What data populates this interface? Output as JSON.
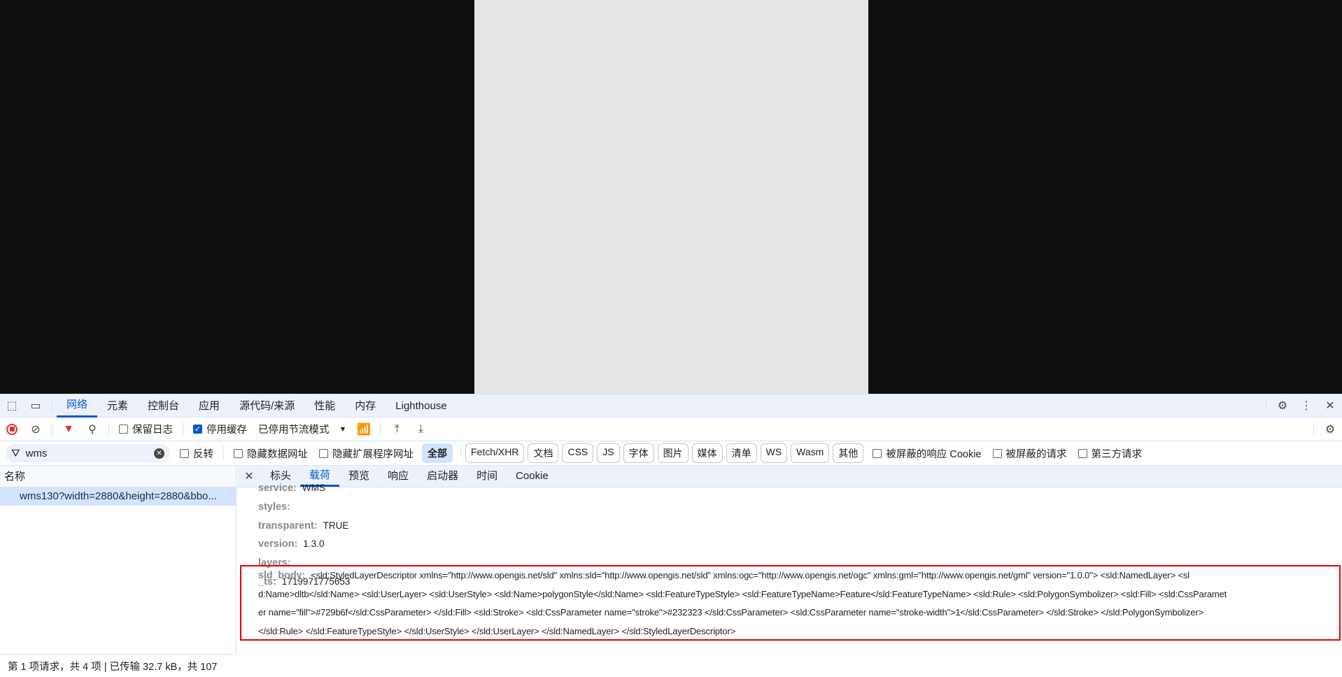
{
  "tabs": [
    "网络",
    "元素",
    "控制台",
    "应用",
    "源代码/来源",
    "性能",
    "内存",
    "Lighthouse"
  ],
  "toolbar": {
    "preserve_log": "保留日志",
    "disable_cache": "停用缓存",
    "throttle": "已停用节流模式"
  },
  "filter": {
    "value": "wms",
    "invert": "反转",
    "hide_data_urls": "隐藏数据网址",
    "hide_ext_urls": "隐藏扩展程序网址",
    "types": [
      "全部",
      "Fetch/XHR",
      "文档",
      "CSS",
      "JS",
      "字体",
      "图片",
      "媒体",
      "清单",
      "WS",
      "Wasm",
      "其他"
    ],
    "blocked_cookies": "被屏蔽的响应 Cookie",
    "blocked_requests": "被屏蔽的请求",
    "third_party": "第三方请求"
  },
  "requests": {
    "header": "名称",
    "items": [
      "wms130?width=2880&height=2880&bbo..."
    ]
  },
  "status": "第 1 项请求，共 4 项  |  已传输 32.7 kB，共 107",
  "detail_tabs": [
    "标头",
    "载荷",
    "预览",
    "响应",
    "启动器",
    "时间",
    "Cookie"
  ],
  "payload": [
    {
      "key": "service:",
      "value": "WMS"
    },
    {
      "key": "styles:",
      "value": ""
    },
    {
      "key": "transparent:",
      "value": "TRUE"
    },
    {
      "key": "version:",
      "value": "1.3.0"
    },
    {
      "key": "layers:",
      "value": ""
    },
    {
      "key": "_ts:",
      "value": "1719971775653"
    }
  ],
  "sld_body": {
    "key": "sld_body:",
    "lines": [
      "<sld:StyledLayerDescriptor xmlns=\"http://www.opengis.net/sld\" xmlns:sld=\"http://www.opengis.net/sld\" xmlns:ogc=\"http://www.opengis.net/ogc\" xmlns:gml=\"http://www.opengis.net/gml\" version=\"1.0.0\"> <sld:NamedLayer> <sl",
      "d:Name>dltb</sld:Name> <sld:UserLayer> <sld:UserStyle> <sld:Name>polygonStyle</sld:Name> <sld:FeatureTypeStyle> <sld:FeatureTypeName>Feature</sld:FeatureTypeName> <sld:Rule> <sld:PolygonSymbolizer> <sld:Fill> <sld:CssParamet",
      "er name=\"fill\">#729b6f</sld:CssParameter> </sld:Fill> <sld:Stroke> <sld:CssParameter name=\"stroke\">#232323 </sld:CssParameter> <sld:CssParameter name=\"stroke-width\">1</sld:CssParameter> </sld:Stroke> </sld:PolygonSymbolizer>",
      "</sld:Rule> </sld:FeatureTypeStyle> </sld:UserStyle> </sld:UserLayer> </sld:NamedLayer> </sld:StyledLayerDescriptor>"
    ]
  },
  "colors": {
    "accent": "#0b57d0",
    "highlight_box": "#e8000b",
    "record": "#dc362e"
  }
}
